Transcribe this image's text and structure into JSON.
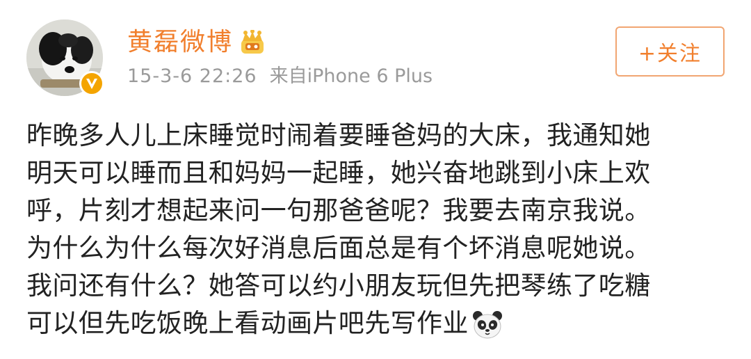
{
  "header": {
    "username": "黄磊微博",
    "timestamp": "15-3-6 22:26",
    "source": "来自iPhone 6 Plus",
    "follow_label": "+关注",
    "badge_icon": "verified-v-badge",
    "vip_icon": "crown-icon"
  },
  "post": {
    "lines": [
      "昨晚多人儿上床睡觉时闹着要睡爸妈的大床，我通知她",
      "明天可以睡而且和妈妈一起睡，她兴奋地跳到小床上欢",
      "呼，片刻才想起来问一句那爸爸呢？我要去南京我说。",
      "为什么为什么每次好消息后面总是有个坏消息呢她说。",
      "我问还有什么？她答可以约小朋友玩但先把琴练了吃糖",
      "可以但先吃饭晚上看动画片吧先写作业"
    ],
    "emoji": "panda-emoji"
  },
  "colors": {
    "username": "#f17f2d",
    "meta": "#9a9a9a",
    "body_text": "#222222",
    "follow_border": "#f1a571",
    "badge": "#f4a400"
  }
}
